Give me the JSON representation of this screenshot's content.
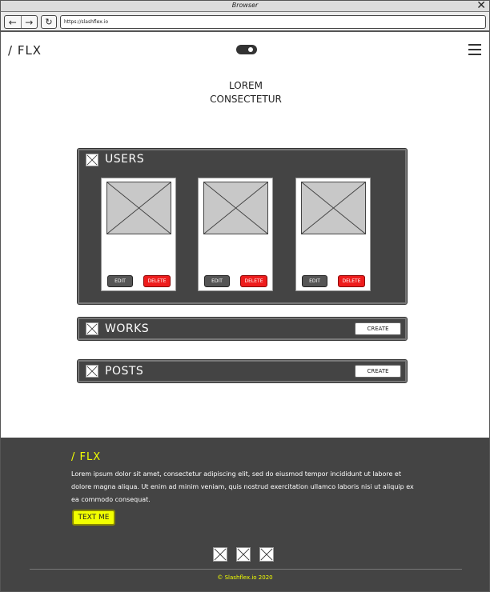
{
  "window": {
    "title": "Browser"
  },
  "browser": {
    "url": "https://slashflex.io"
  },
  "header": {
    "logo": "/ FLX"
  },
  "hero": {
    "line1": "LOREM",
    "line2": "CONSECTETUR"
  },
  "sections": {
    "users": {
      "title": "USERS",
      "cards": [
        {
          "edit_label": "EDIT",
          "delete_label": "DELETE"
        },
        {
          "edit_label": "EDIT",
          "delete_label": "DELETE"
        },
        {
          "edit_label": "EDIT",
          "delete_label": "DELETE"
        }
      ]
    },
    "works": {
      "title": "WORKS",
      "create_label": "CREATE"
    },
    "posts": {
      "title": "POSTS",
      "create_label": "CREATE"
    }
  },
  "footer": {
    "logo": "/ FLX",
    "text": "Lorem ipsum dolor sit amet, consectetur adipiscing elit, sed do eiusmod tempor incididunt ut labore et dolore magna aliqua. Ut enim ad minim veniam, quis nostrud exercitation ullamco laboris nisi ut aliquip ex ea commodo consequat.",
    "cta_label": "TEXT ME",
    "copyright": "© Slashflex.io 2020"
  },
  "colors": {
    "panel_bg": "#444444",
    "accent_yellow": "#f2ff00",
    "delete_red": "#ee1c1c"
  },
  "icons": [
    "close-icon",
    "back-arrow-icon",
    "forward-arrow-icon",
    "refresh-icon",
    "toggle-icon",
    "menu-icon",
    "image-placeholder-icon",
    "checkbox-icon",
    "social-icon"
  ]
}
